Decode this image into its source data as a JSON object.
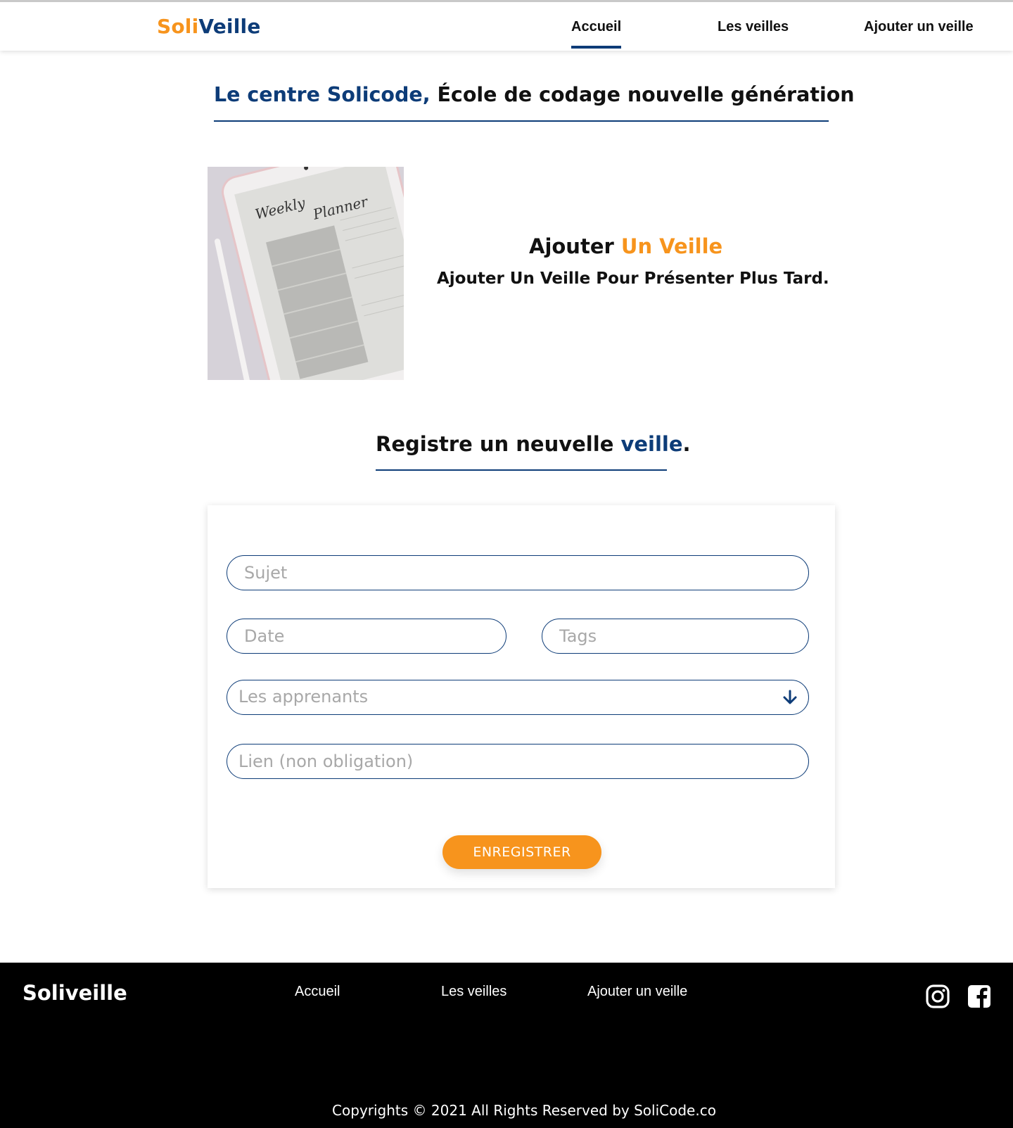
{
  "header": {
    "brand_part1": "Soli",
    "brand_part2": "Veille",
    "nav": [
      "Accueil",
      "Les veilles",
      "Ajouter un veille"
    ],
    "active": "Accueil"
  },
  "hero": {
    "title_blue": "Le centre Solicode,",
    "title_rest": " École de codage nouvelle génération"
  },
  "image": {
    "title_line1": "Weekly",
    "title_line2": "Planner"
  },
  "add_block": {
    "title_black": "Ajouter ",
    "title_orange": "Un Veille",
    "subtitle": "Ajouter Un Veille Pour Présenter Plus Tard."
  },
  "register": {
    "title_black": "Registre un neuvelle ",
    "title_blue": "veille",
    "title_end": "."
  },
  "form": {
    "sujet_placeholder": "Sujet",
    "date_placeholder": "Date",
    "tags_placeholder": "Tags",
    "apprenants_placeholder": "Les apprenants",
    "lien_placeholder": "Lien (non obligation)",
    "submit_label": "ENREGISTRER"
  },
  "footer": {
    "brand": "Soliveille",
    "links": [
      "Accueil",
      "Les veilles",
      "Ajouter un veille"
    ],
    "copyright": "Copyrights © 2021 All Rights Reserved by SoliCode.co",
    "social": [
      "instagram-icon",
      "facebook-icon"
    ]
  },
  "colors": {
    "brand_orange": "#f7941d",
    "brand_blue": "#0d3c78",
    "footer_bg": "#000000"
  }
}
